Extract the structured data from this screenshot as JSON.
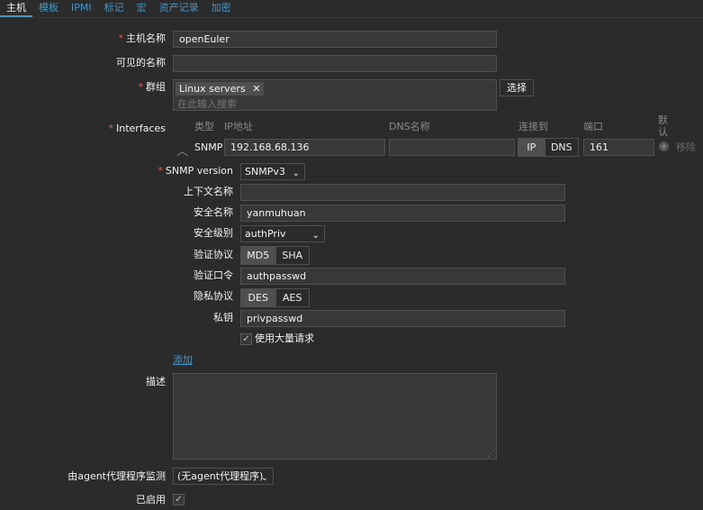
{
  "tabs": [
    "主机",
    "模板",
    "IPMI",
    "标记",
    "宏",
    "资产记录",
    "加密"
  ],
  "host": {
    "hostname_label": "主机名称",
    "hostname_value": "openEuler",
    "visible_name_label": "可见的名称",
    "visible_name_value": "",
    "groups_label": "群组",
    "group_tag": "Linux servers",
    "groups_placeholder": "在此输入搜索",
    "select_button": "选择"
  },
  "interfaces": {
    "label": "Interfaces",
    "headers": {
      "type": "类型",
      "ip": "IP地址",
      "dns": "DNS名称",
      "connect": "连接到",
      "port": "端口",
      "default": "默认"
    },
    "row": {
      "type": "SNMP",
      "ip": "192.168.68.136",
      "dns": "",
      "ip_btn": "IP",
      "dns_btn": "DNS",
      "port": "161",
      "remove": "移除",
      "connect_selected": "IP"
    }
  },
  "snmp": {
    "version_label": "SNMP version",
    "version_value": "SNMPv3",
    "context_label": "上下文名称",
    "context_value": "",
    "secname_label": "安全名称",
    "secname_value": "yanmuhuan",
    "seclevel_label": "安全级别",
    "seclevel_value": "authPriv",
    "authproto_label": "验证协议",
    "authproto_options": [
      "MD5",
      "SHA"
    ],
    "authproto_selected": "MD5",
    "authpass_label": "验证口令",
    "authpass_value": "authpasswd",
    "privproto_label": "隐私协议",
    "privproto_options": [
      "DES",
      "AES"
    ],
    "privproto_selected": "DES",
    "privkey_label": "私钥",
    "privkey_value": "privpasswd",
    "bulk_label": "使用大量请求",
    "bulk_checked": true
  },
  "add_link": "添加",
  "description_label": "描述",
  "description_value": "",
  "proxy_label": "由agent代理程序监测",
  "proxy_value": "(无agent代理程序)",
  "enabled_label": "已启用",
  "enabled_checked": true
}
